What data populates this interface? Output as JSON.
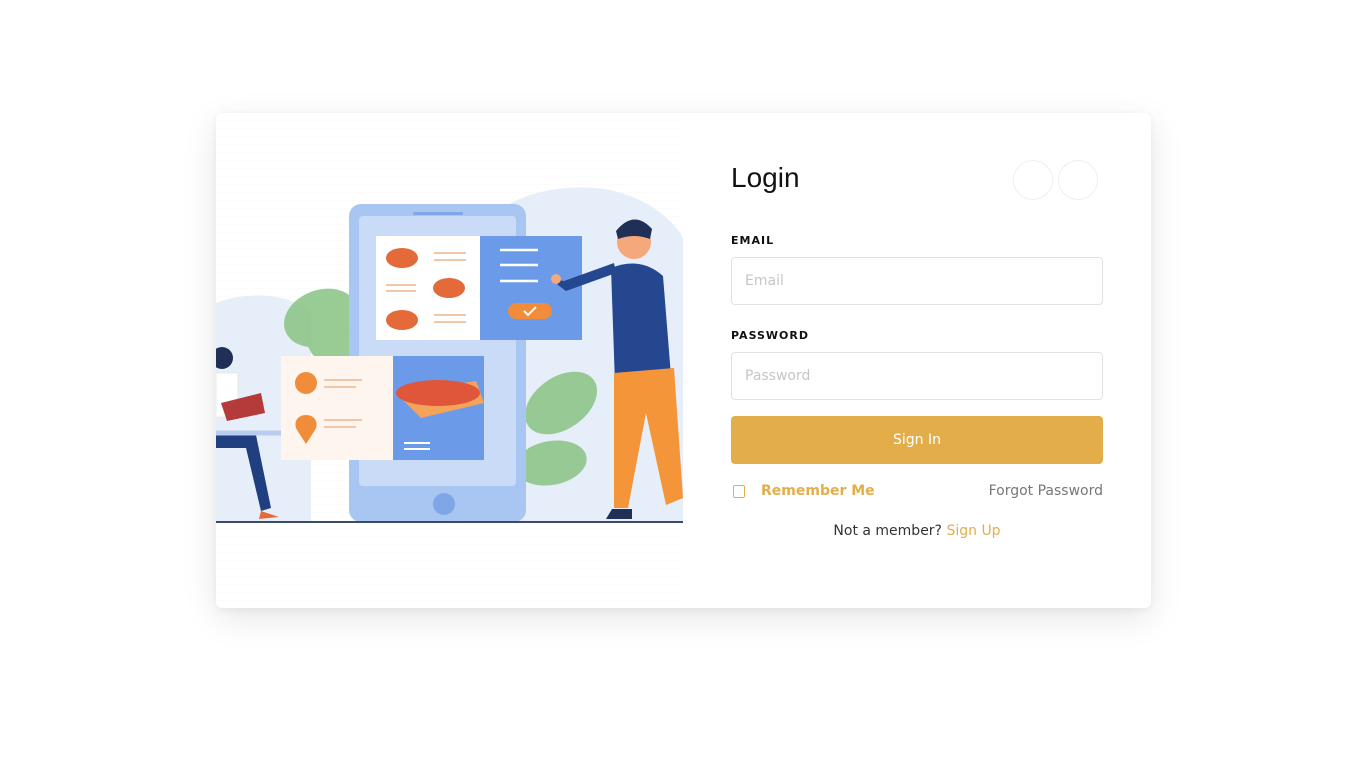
{
  "login": {
    "title": "Login",
    "email_label": "EMAIL",
    "email_placeholder": "Email",
    "email_value": "",
    "password_label": "PASSWORD",
    "password_placeholder": "Password",
    "password_value": "",
    "signin_label": "Sign In",
    "remember_label": "Remember Me",
    "remember_checked": false,
    "forgot_label": "Forgot Password",
    "not_member_text": "Not a member?",
    "signup_label": "Sign Up"
  },
  "social_buttons": [
    {
      "icon": "social-login-icon"
    },
    {
      "icon": "social-login-icon"
    }
  ],
  "illustration": {
    "subject": "food-delivery-app-illustration"
  },
  "colors": {
    "accent": "#e3ae4a",
    "background": "#ffffff",
    "card": "#ffffff",
    "input_border": "#e2e2e2",
    "muted_text": "#777777"
  }
}
